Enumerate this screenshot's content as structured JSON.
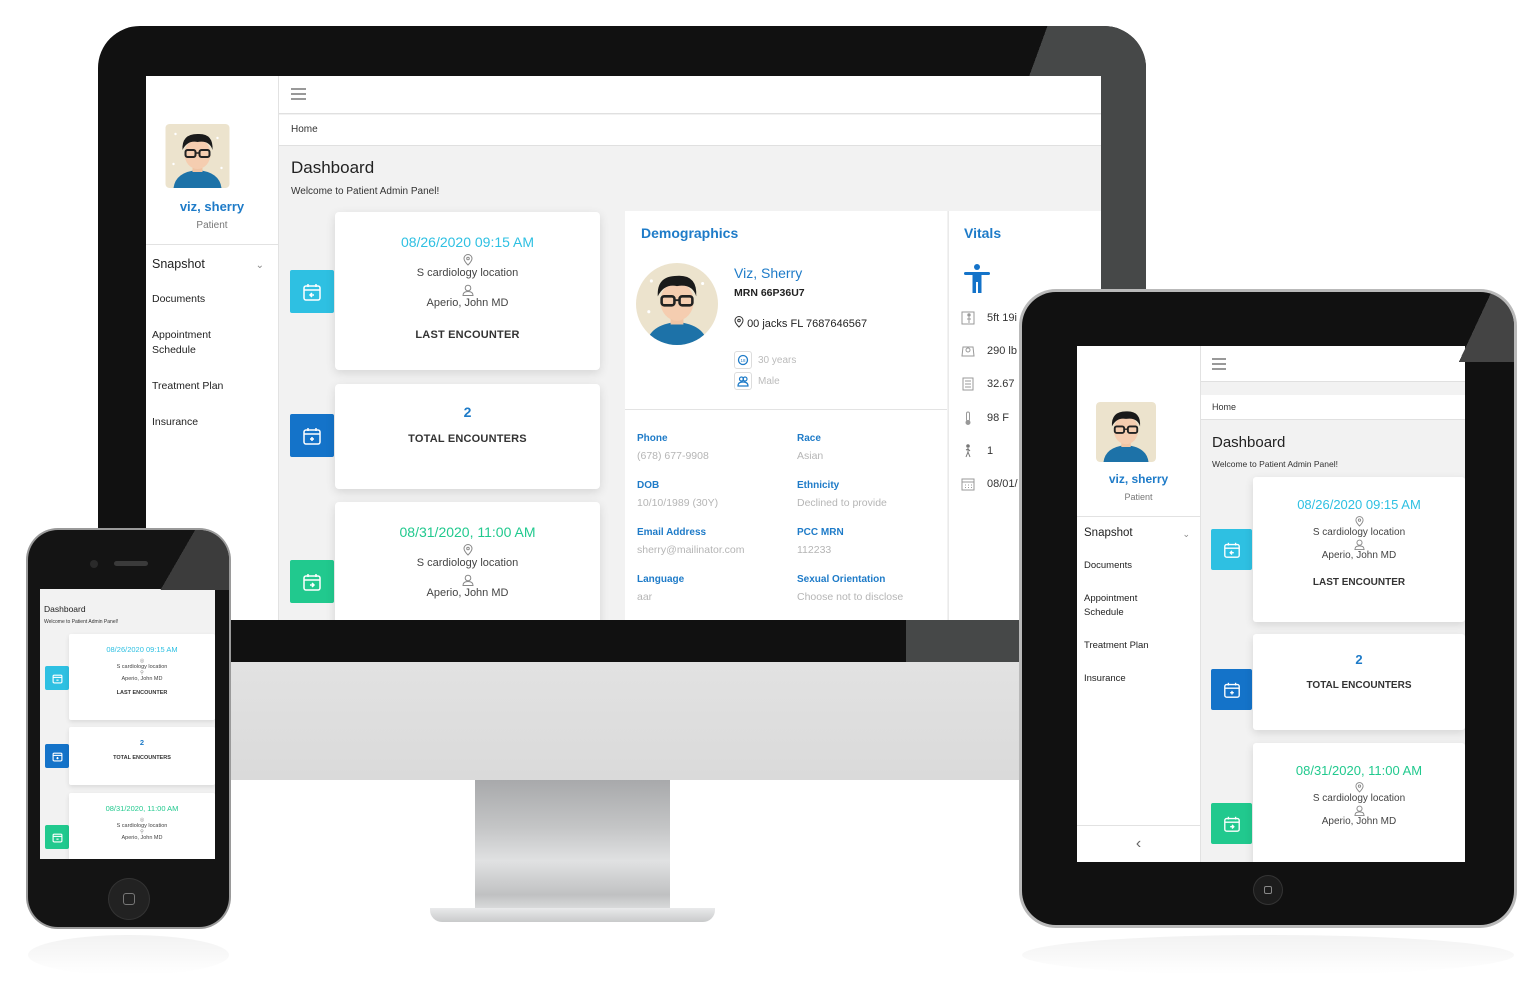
{
  "app": {
    "breadcrumb": "Home",
    "page_title": "Dashboard",
    "page_subtitle": "Welcome to Patient Admin Panel!"
  },
  "colors": {
    "primary_blue": "#1e7bc8",
    "cyan": "#2ec0e2",
    "dark_blue": "#1473c9",
    "green": "#21c98e"
  },
  "sidebar": {
    "user_name": "viz, sherry",
    "user_role": "Patient",
    "items": [
      {
        "label": "Snapshot",
        "icon": "chevron-down-icon"
      },
      {
        "label": "Documents"
      },
      {
        "label": "Appointment Schedule"
      },
      {
        "label": "Treatment Plan"
      },
      {
        "label": "Insurance"
      }
    ],
    "collapse_icon": "chevron-left-icon",
    "collapse_glyph": "‹"
  },
  "encounters": {
    "last": {
      "datetime": "08/26/2020 09:15 AM",
      "location": "S cardiology location",
      "provider": "Aperio, John MD",
      "label": "LAST ENCOUNTER"
    },
    "total": {
      "count": "2",
      "label": "TOTAL ENCOUNTERS"
    },
    "next": {
      "datetime": "08/31/2020, 11:00 AM",
      "location": "S cardiology location",
      "provider": "Aperio, John MD"
    }
  },
  "demographics": {
    "title": "Demographics",
    "name": "Viz, Sherry",
    "mrn": "MRN 66P36U7",
    "address": "00 jacks FL 7687646567",
    "age": "30 years",
    "gender": "Male",
    "fields": [
      {
        "label": "Phone",
        "value": "(678) 677-9908"
      },
      {
        "label": "Race",
        "value": "Asian"
      },
      {
        "label": "DOB",
        "value": "10/10/1989 (30Y)"
      },
      {
        "label": "Ethnicity",
        "value": "Declined to provide"
      },
      {
        "label": "Email Address",
        "value": "sherry@mailinator.com"
      },
      {
        "label": "PCC MRN",
        "value": "112233"
      },
      {
        "label": "Language",
        "value": "aar"
      },
      {
        "label": "Sexual Orientation",
        "value": "Choose not to disclose"
      }
    ]
  },
  "vitals": {
    "title": "Vitals",
    "items": [
      {
        "icon": "height-icon",
        "value": "5ft 19i"
      },
      {
        "icon": "weight-scale-icon",
        "value": "290 lb"
      },
      {
        "icon": "bmi-calculator-icon",
        "value": "32.67"
      },
      {
        "icon": "thermometer-icon",
        "value": "98 F"
      },
      {
        "icon": "walking-person-icon",
        "value": "1"
      },
      {
        "icon": "calendar-icon",
        "value": "08/01/"
      }
    ]
  }
}
